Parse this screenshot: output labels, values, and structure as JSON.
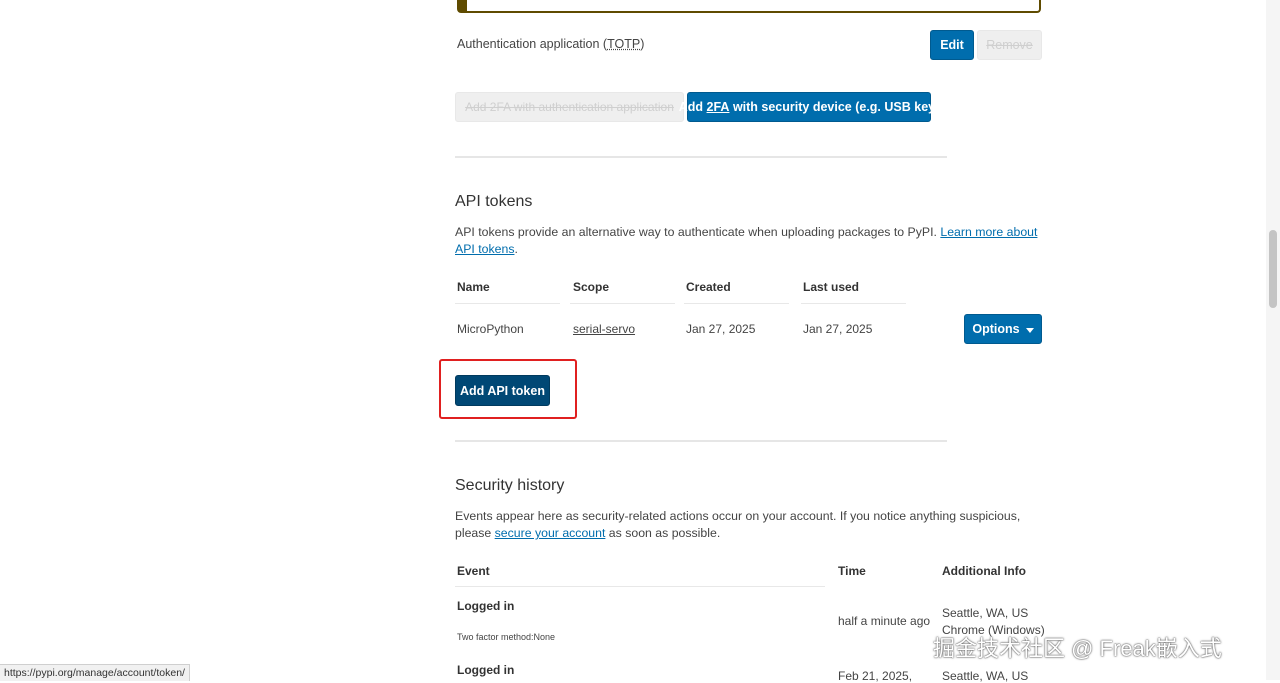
{
  "twofa": {
    "auth_app_label_prefix": "Authentication application (",
    "auth_app_abbr": "TOTP",
    "auth_app_label_suffix": ")",
    "edit_label": "Edit",
    "remove_label": "Remove",
    "add_auth_app_label": "Add 2FA with authentication application",
    "add_security_device_prefix": "Add ",
    "add_security_device_abbr": "2FA",
    "add_security_device_suffix": " with security device (e.g. USB key)"
  },
  "api_tokens": {
    "title": "API tokens",
    "description": "API tokens provide an alternative way to authenticate when uploading packages to PyPI. ",
    "learn_more_link": "Learn more about API tokens",
    "description_end": ".",
    "columns": [
      "Name",
      "Scope",
      "Created",
      "Last used"
    ],
    "rows": [
      {
        "name": "MicroPython",
        "scope": "serial-servo",
        "created": "Jan 27, 2025",
        "last_used": "Jan 27, 2025",
        "options_label": "Options"
      }
    ],
    "add_token_label": "Add API token"
  },
  "security_history": {
    "title": "Security history",
    "description_start": "Events appear here as security-related actions occur on your account. If you notice anything suspicious, please ",
    "secure_link": "secure your account",
    "description_end": " as soon as possible.",
    "columns": [
      "Event",
      "Time",
      "Additional Info"
    ],
    "rows": [
      {
        "event": "Logged in",
        "detail": "Two factor method:None",
        "time": "half a minute ago",
        "location": "Seattle, WA, US",
        "browser": "Chrome (Windows)"
      },
      {
        "event": "Logged in",
        "time": "Feb 21, 2025,",
        "location": "Seattle, WA, US"
      }
    ]
  },
  "status_bar": {
    "url": "https://pypi.org/manage/account/token/"
  },
  "watermark": "掘金技术社区 @ Freak嵌入式",
  "colors": {
    "primary": "#006dad",
    "primary_dark": "#004875",
    "highlight_box": "#e02020",
    "alert_border": "#5f4b00"
  }
}
